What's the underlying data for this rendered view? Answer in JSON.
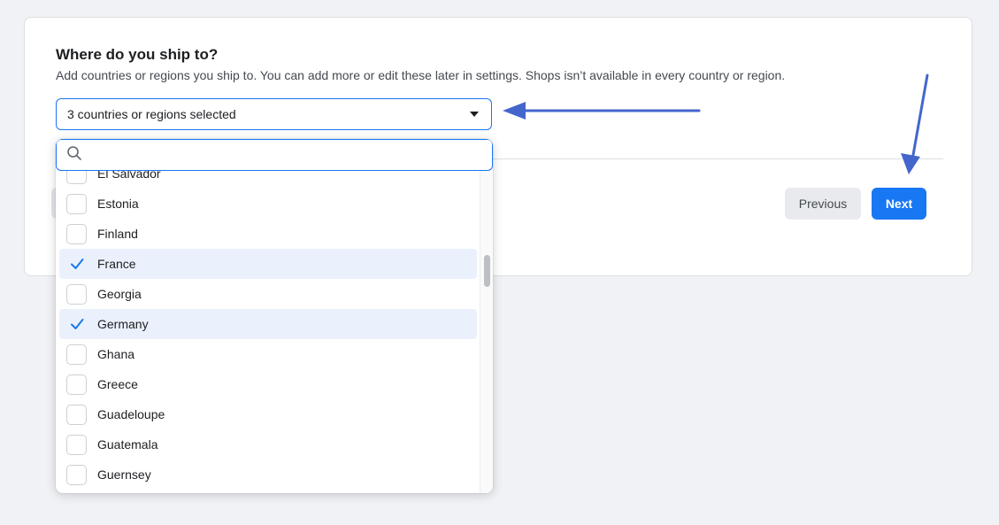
{
  "header": {
    "title": "Where do you ship to?",
    "subtitle": "Add countries or regions you ship to. You can add more or edit these later in settings. Shops isn’t available in every country or region."
  },
  "select": {
    "value": "3 countries or regions selected",
    "icon": "caret-down-icon"
  },
  "search": {
    "placeholder": "",
    "value": "",
    "icon": "search-icon"
  },
  "countries": [
    {
      "label": "El Salvador",
      "checked": false
    },
    {
      "label": "Estonia",
      "checked": false
    },
    {
      "label": "Finland",
      "checked": false
    },
    {
      "label": "France",
      "checked": true
    },
    {
      "label": "Georgia",
      "checked": false
    },
    {
      "label": "Germany",
      "checked": true
    },
    {
      "label": "Ghana",
      "checked": false
    },
    {
      "label": "Greece",
      "checked": false
    },
    {
      "label": "Guadeloupe",
      "checked": false
    },
    {
      "label": "Guatemala",
      "checked": false
    },
    {
      "label": "Guernsey",
      "checked": false
    },
    {
      "label": "",
      "checked": false
    }
  ],
  "buttons": {
    "previous": "Previous",
    "next": "Next"
  },
  "colors": {
    "accent": "#1877f2",
    "annotation_arrow": "#4466cc",
    "checked_row": "#eaf1fd"
  }
}
